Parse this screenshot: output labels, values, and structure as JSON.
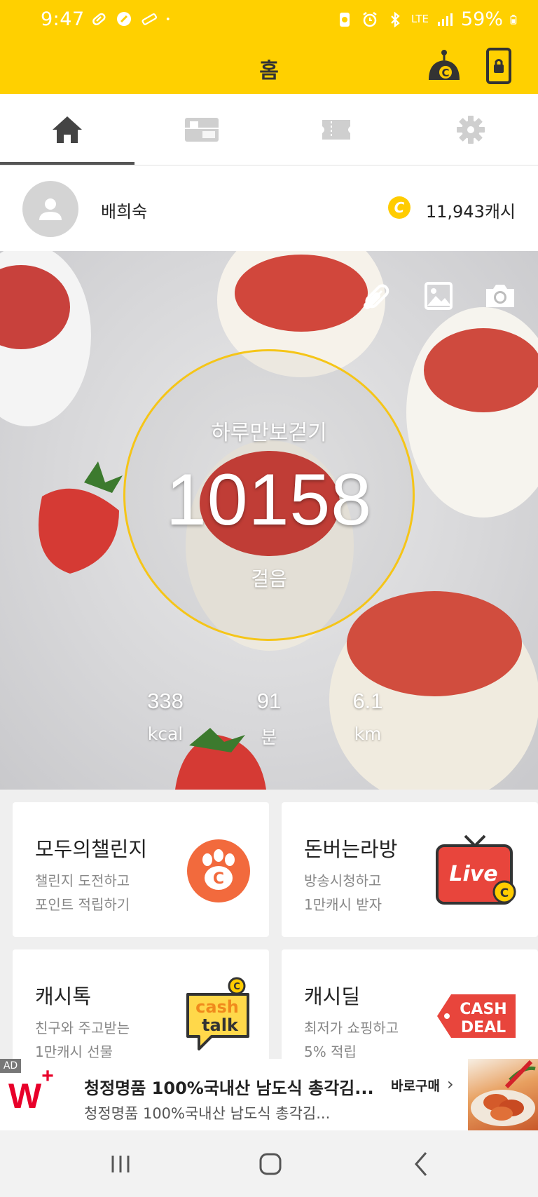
{
  "status_bar": {
    "time": "9:47",
    "network": "LTE",
    "battery": "59%"
  },
  "header": {
    "title": "홈",
    "accent_color": "#ffd000"
  },
  "tabs": [
    {
      "icon": "home-icon",
      "active": true
    },
    {
      "icon": "gift-card-icon",
      "active": false
    },
    {
      "icon": "ticket-icon",
      "active": false
    },
    {
      "icon": "gear-icon",
      "active": false
    }
  ],
  "profile": {
    "name": "배희숙",
    "cash": "11,943캐시"
  },
  "pedometer": {
    "label": "하루만보걷기",
    "steps": "10158",
    "unit": "걸음",
    "ring_color": "#f5c518",
    "stats": [
      {
        "value": "338",
        "unit": "kcal"
      },
      {
        "value": "91",
        "unit": "분"
      },
      {
        "value": "6.1",
        "unit": "km"
      }
    ]
  },
  "cards": [
    {
      "title": "모두의챌린지",
      "line1": "챌린지 도전하고",
      "line2": "포인트 적립하기",
      "icon": "challenge-paw-icon"
    },
    {
      "title": "돈버는라방",
      "line1": "방송시청하고",
      "line2": "1만캐시 받자",
      "icon": "live-tv-icon",
      "icon_text": "Live"
    },
    {
      "title": "캐시톡",
      "line1": "친구와 주고받는",
      "line2": "1만캐시 선물",
      "icon": "cashtalk-icon",
      "icon_text_1": "cash",
      "icon_text_2": "talk"
    },
    {
      "title": "캐시딜",
      "line1": "최저가 쇼핑하고",
      "line2": "5% 적립",
      "icon": "cashdeal-tag-icon",
      "icon_text_1": "CASH",
      "icon_text_2": "DEAL"
    }
  ],
  "ad": {
    "badge": "AD",
    "logo": "W",
    "logo_plus": "+",
    "title": "청정명품 100%국내산 남도식 총각김...",
    "subtitle": "청정명품 100%국내산 남도식 총각김...",
    "cta": "바로구매"
  }
}
